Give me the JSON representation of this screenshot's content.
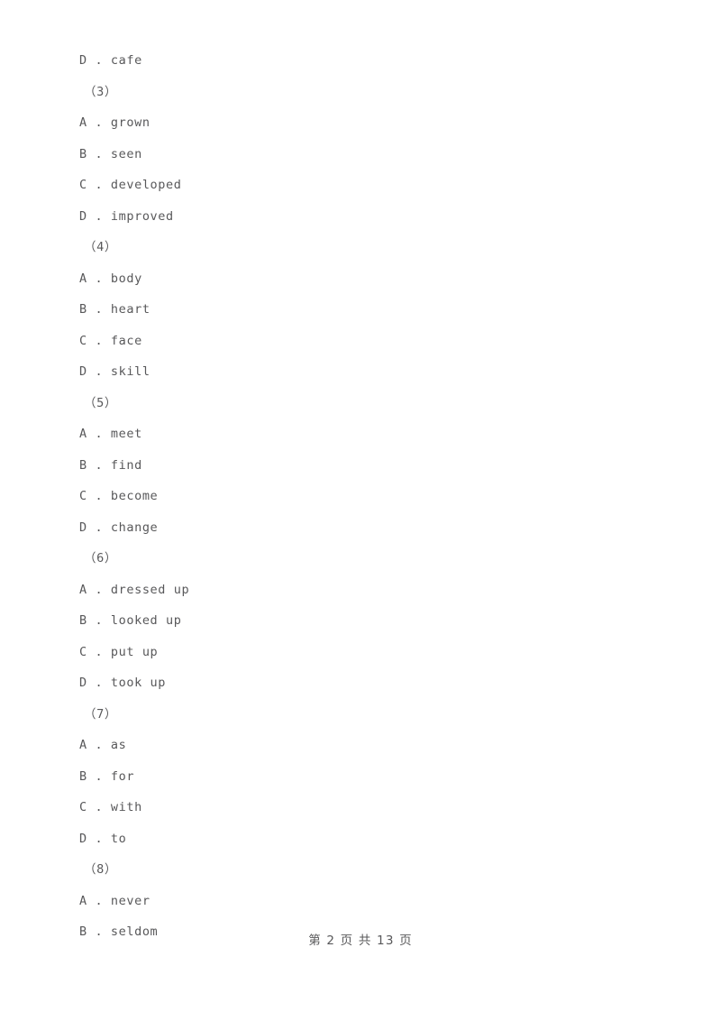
{
  "document": {
    "lines": [
      {
        "kind": "option",
        "text": "D . cafe"
      },
      {
        "kind": "qnum",
        "text": "（3）"
      },
      {
        "kind": "option",
        "text": "A . grown"
      },
      {
        "kind": "option",
        "text": "B . seen"
      },
      {
        "kind": "option",
        "text": "C . developed"
      },
      {
        "kind": "option",
        "text": "D . improved"
      },
      {
        "kind": "qnum",
        "text": "（4）"
      },
      {
        "kind": "option",
        "text": "A . body"
      },
      {
        "kind": "option",
        "text": "B . heart"
      },
      {
        "kind": "option",
        "text": "C . face"
      },
      {
        "kind": "option",
        "text": "D . skill"
      },
      {
        "kind": "qnum",
        "text": "（5）"
      },
      {
        "kind": "option",
        "text": "A . meet"
      },
      {
        "kind": "option",
        "text": "B . find"
      },
      {
        "kind": "option",
        "text": "C . become"
      },
      {
        "kind": "option",
        "text": "D . change"
      },
      {
        "kind": "qnum",
        "text": "（6）"
      },
      {
        "kind": "option",
        "text": "A . dressed up"
      },
      {
        "kind": "option",
        "text": "B . looked up"
      },
      {
        "kind": "option",
        "text": "C . put up"
      },
      {
        "kind": "option",
        "text": "D . took up"
      },
      {
        "kind": "qnum",
        "text": "（7）"
      },
      {
        "kind": "option",
        "text": "A . as"
      },
      {
        "kind": "option",
        "text": "B . for"
      },
      {
        "kind": "option",
        "text": "C . with"
      },
      {
        "kind": "option",
        "text": "D . to"
      },
      {
        "kind": "qnum",
        "text": "（8）"
      },
      {
        "kind": "option",
        "text": "A . never"
      },
      {
        "kind": "option",
        "text": "B . seldom"
      }
    ]
  },
  "footer": {
    "text": "第 2 页 共 13 页",
    "current_page": "2",
    "total_pages": "13"
  },
  "colors": {
    "text": "#58585a",
    "background": "#ffffff"
  }
}
